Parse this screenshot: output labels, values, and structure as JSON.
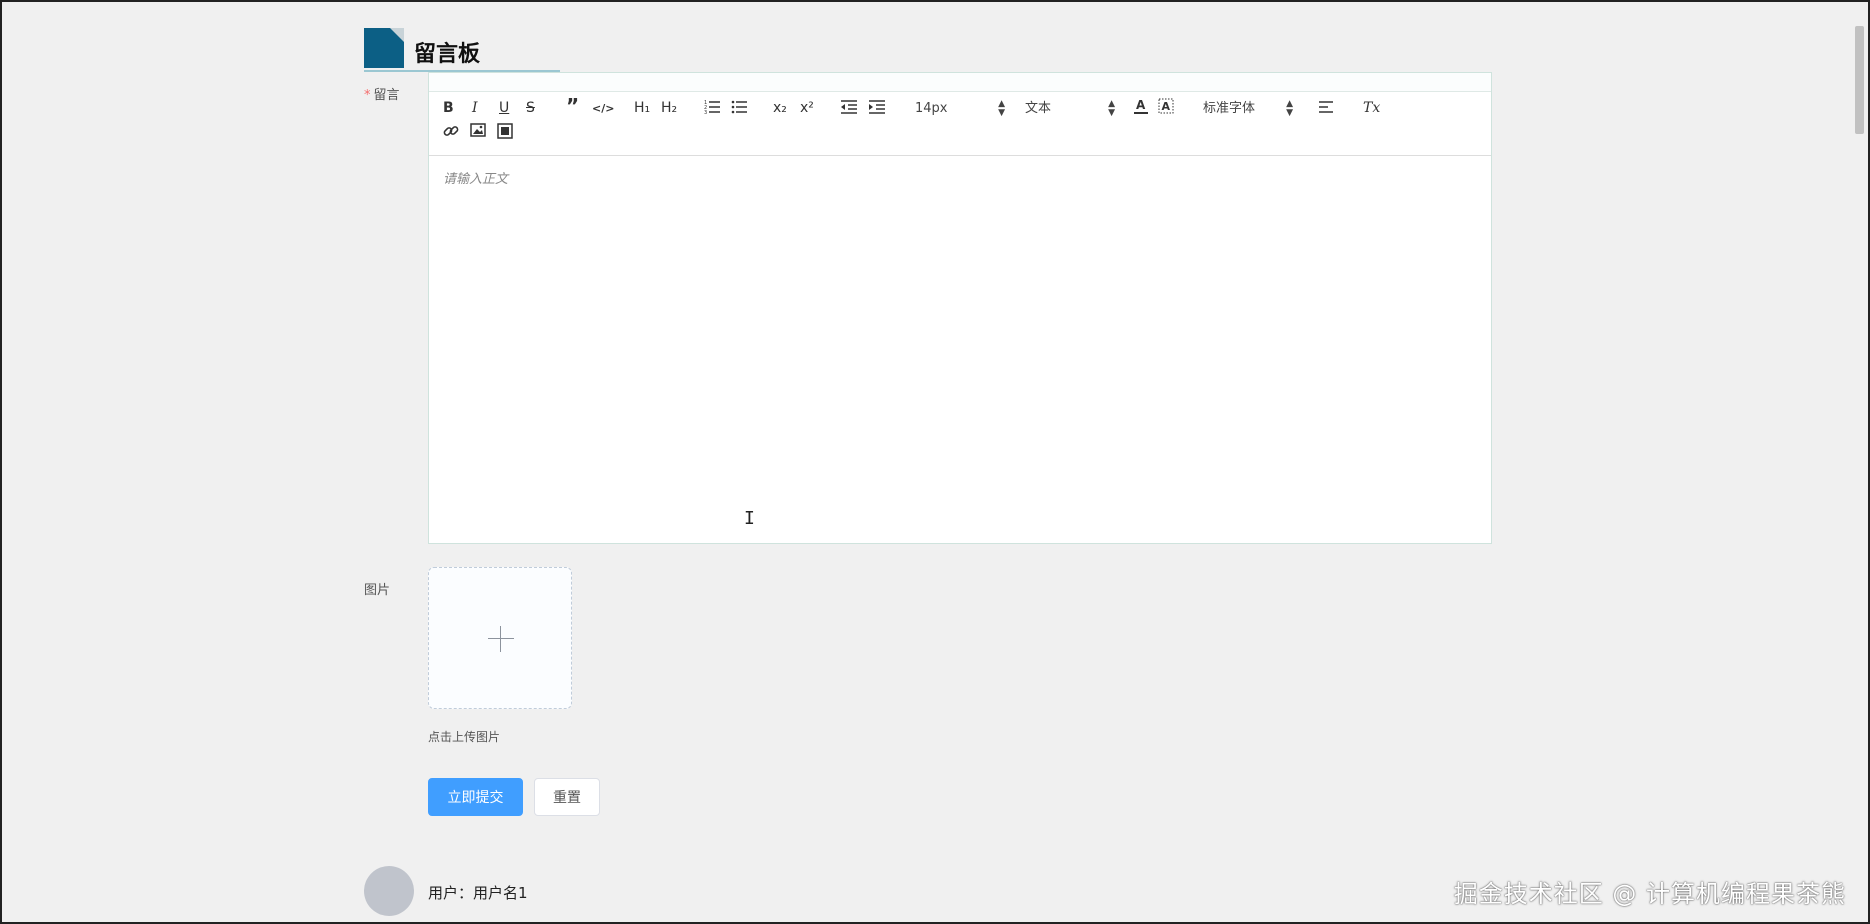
{
  "page": {
    "title": "留言板"
  },
  "form": {
    "message_label": "留言",
    "required_mark": "*",
    "image_label": "图片",
    "upload_tip": "点击上传图片",
    "submit_label": "立即提交",
    "reset_label": "重置"
  },
  "editor": {
    "placeholder": "请输入正文",
    "toolbar": {
      "bold": "B",
      "italic": "I",
      "underline": "U",
      "strike": "S",
      "blockquote": "”",
      "code": "</>",
      "h1": "H₁",
      "h2": "H₂",
      "subscript": "x₂",
      "superscript": "x²",
      "size_value": "14px",
      "header_value": "文本",
      "font_value": "标准字体",
      "clean": "Tx"
    }
  },
  "comments": [
    {
      "user_label": "用户：用户名1"
    }
  ],
  "watermark": "掘金技术社区 @ 计算机编程果茶熊"
}
